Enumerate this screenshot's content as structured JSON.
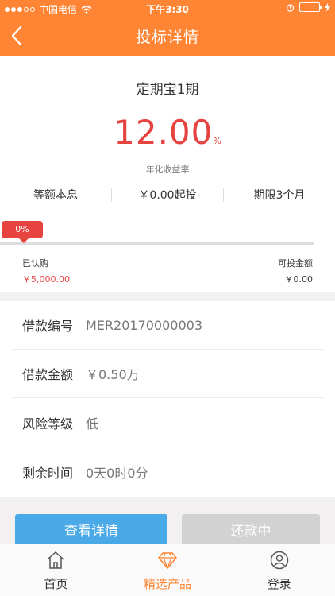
{
  "status_bar": {
    "carrier": "中国电信",
    "time": "下午3:30"
  },
  "nav": {
    "title": "投标详情",
    "back_icon": "chevron-left-icon"
  },
  "product": {
    "name": "定期宝1期",
    "rate_value": "12.00",
    "rate_unit": "%",
    "rate_label": "年化收益率",
    "repayment": "等额本息",
    "min_invest": "￥0.00起投",
    "term": "期限3个月"
  },
  "progress": {
    "percent_label": "0%",
    "fraction": 0,
    "subscribed_label": "已认购",
    "subscribed_value": "￥5,000.00",
    "available_label": "可投金额",
    "available_value": "￥0.00"
  },
  "details": [
    {
      "key": "借款编号",
      "value": "MER20170000003"
    },
    {
      "key": "借款金额",
      "value": "￥0.50万"
    },
    {
      "key": "风险等级",
      "value": "低"
    },
    {
      "key": "剩余时间",
      "value": "0天0时0分"
    }
  ],
  "actions": {
    "view_details": "查看详情",
    "status": "还款中"
  },
  "tabs": [
    {
      "label": "首页",
      "icon": "home-icon"
    },
    {
      "label": "精选产品",
      "icon": "diamond-icon"
    },
    {
      "label": "登录",
      "icon": "user-icon"
    }
  ],
  "colors": {
    "brand": "#ff8433",
    "accent_red": "#e64340",
    "button_blue": "#4aa9e7",
    "button_disabled": "#d2d2d2"
  }
}
